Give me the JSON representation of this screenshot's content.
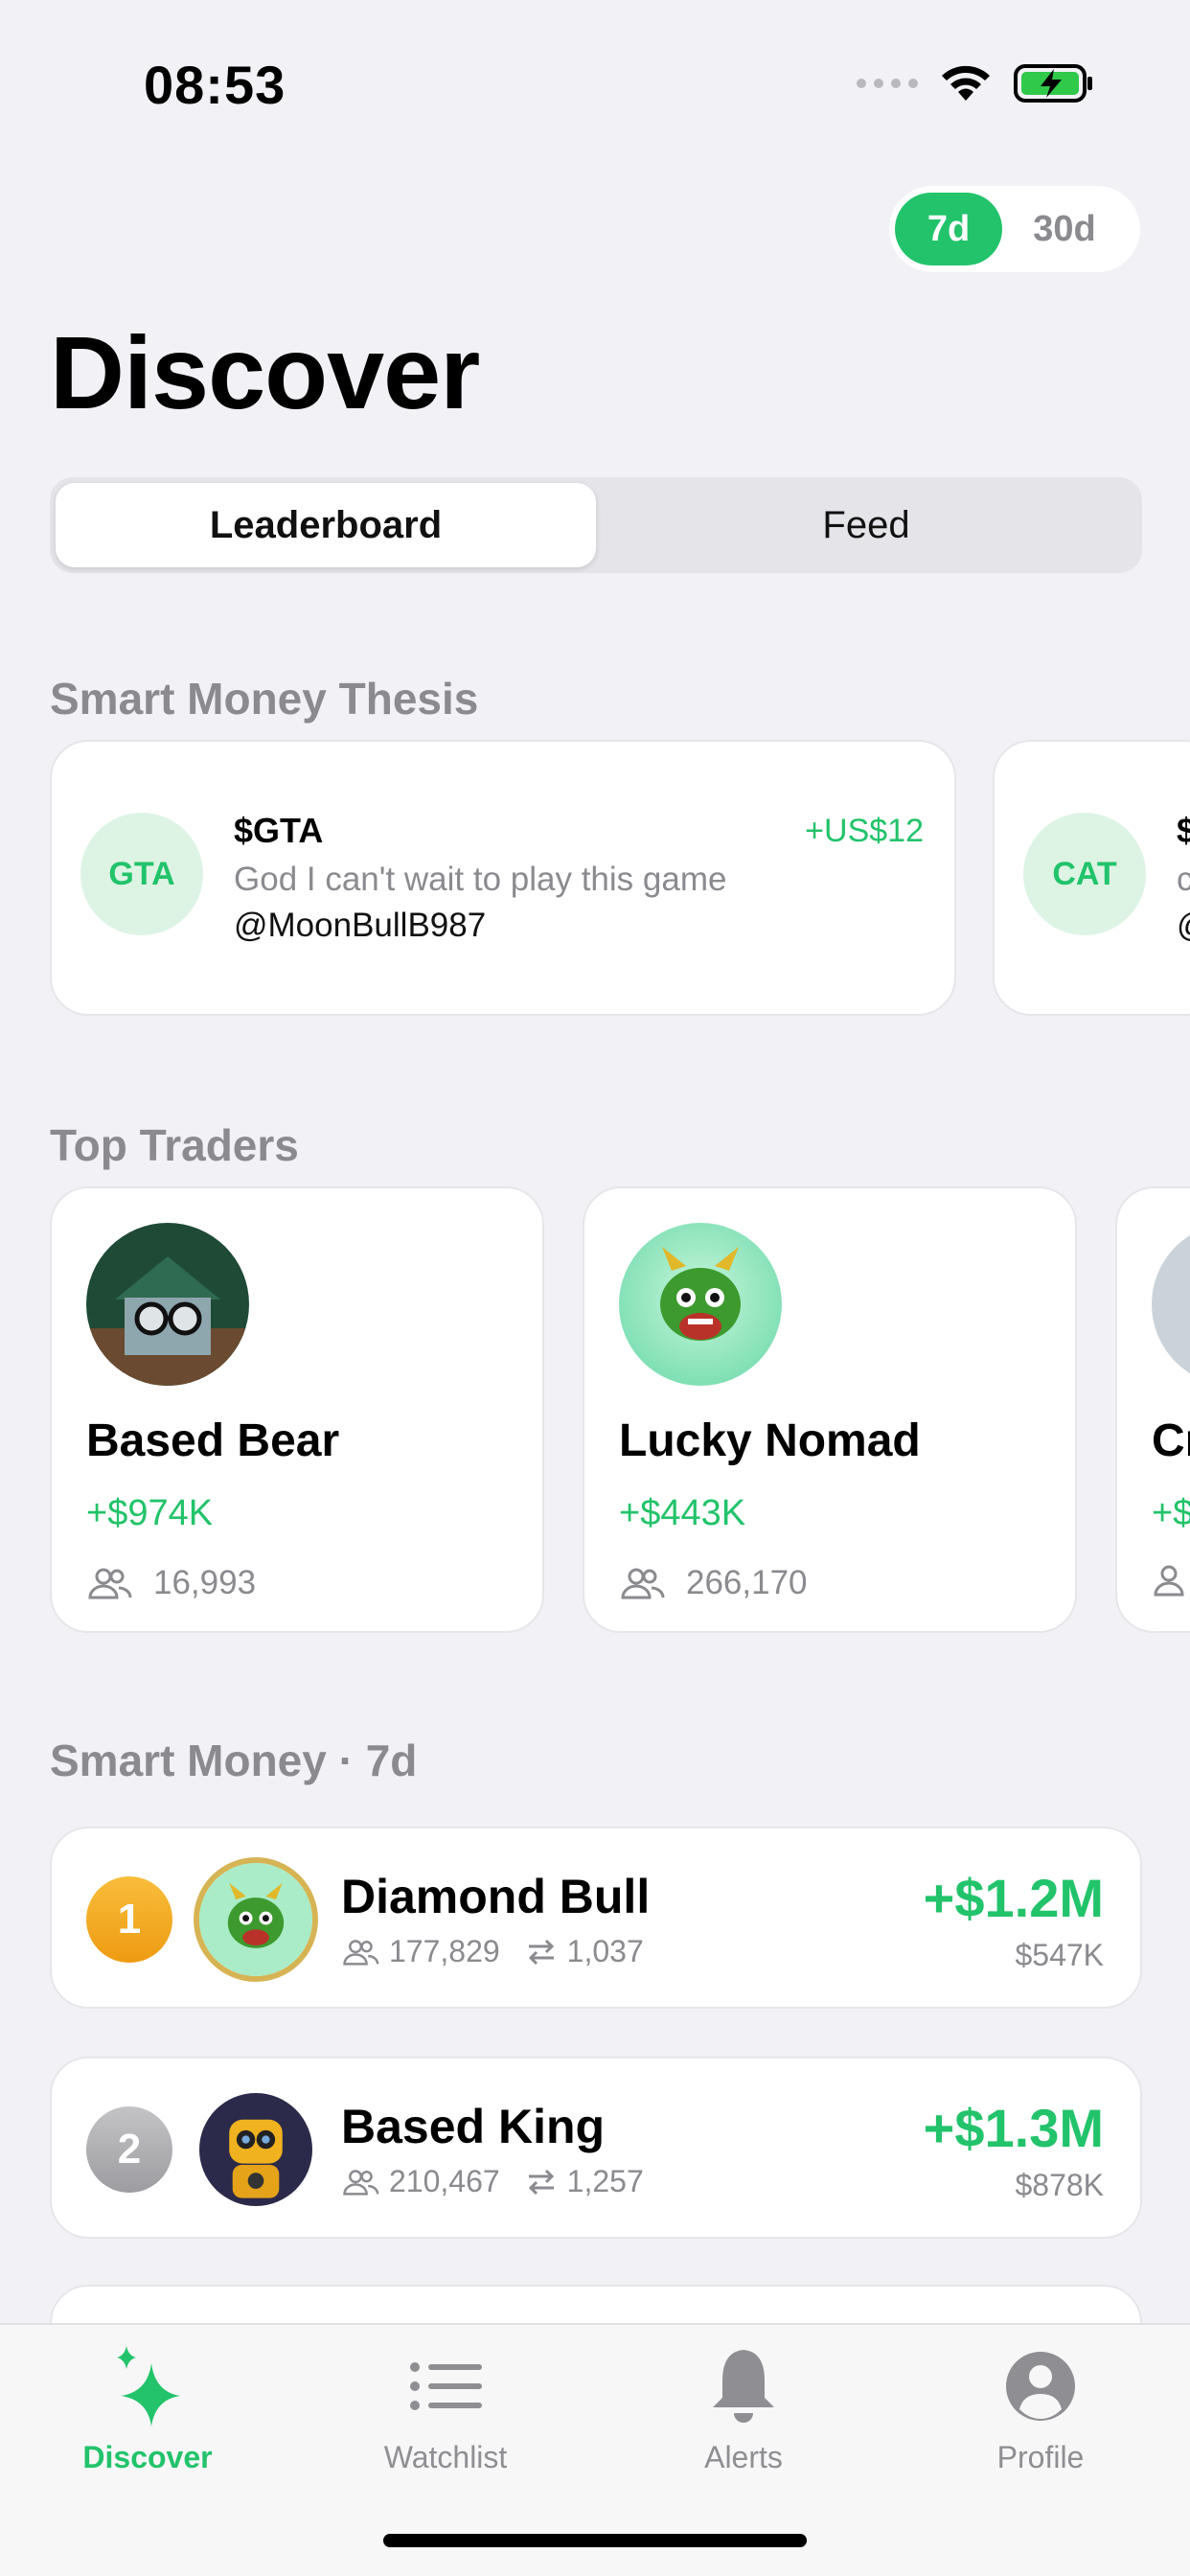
{
  "status_bar": {
    "time": "08:53"
  },
  "period_toggle": {
    "options": [
      "7d",
      "30d"
    ],
    "selected": "7d"
  },
  "page_title": "Discover",
  "segments": {
    "items": [
      "Leaderboard",
      "Feed"
    ],
    "selected": "Leaderboard"
  },
  "thesis_section": {
    "title": "Smart Money Thesis",
    "cards": [
      {
        "avatar_text": "GTA",
        "ticker": "$GTA",
        "change": "+US$12",
        "text": "God I can't wait to play this game",
        "user": "@MoonBullB987"
      },
      {
        "avatar_text": "CAT",
        "ticker": "$",
        "change": "",
        "text": "c",
        "user": "@"
      }
    ]
  },
  "top_traders": {
    "title": "Top Traders",
    "cards": [
      {
        "name": "Based Bear",
        "pnl": "+$974K",
        "followers": "16,993"
      },
      {
        "name": "Lucky Nomad",
        "pnl": "+$443K",
        "followers": "266,170"
      },
      {
        "name": "Cr",
        "pnl": "+$",
        "followers": ""
      }
    ]
  },
  "smart_money": {
    "title": "Smart Money · 7d",
    "rows": [
      {
        "rank": "1",
        "name": "Diamond Bull",
        "followers": "177,829",
        "trades": "1,037",
        "pnl": "+$1.2M",
        "volume": "$547K"
      },
      {
        "rank": "2",
        "name": "Based King",
        "followers": "210,467",
        "trades": "1,257",
        "pnl": "+$1.3M",
        "volume": "$878K"
      }
    ]
  },
  "tabbar": {
    "items": [
      {
        "label": "Discover",
        "icon": "sparkle-icon"
      },
      {
        "label": "Watchlist",
        "icon": "list-icon"
      },
      {
        "label": "Alerts",
        "icon": "bell-icon"
      },
      {
        "label": "Profile",
        "icon": "person-icon"
      }
    ],
    "active": "Discover"
  },
  "colors": {
    "accent": "#22c36a",
    "gold": "#f3a51a",
    "silver": "#a9a9ad"
  }
}
